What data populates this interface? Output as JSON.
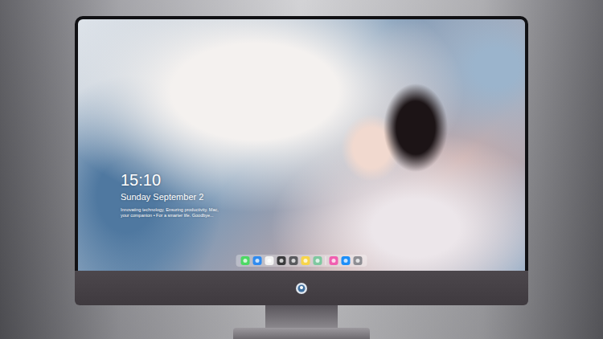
{
  "clock": {
    "time": "15:10",
    "date": "Sunday September 2",
    "tagline_lines": [
      "Innovating technology, Ensuring productivity. Mac,",
      "your companion • For a smarter life. Goodbye..."
    ]
  },
  "dock": {
    "apps": [
      {
        "color": "#4cd964"
      },
      {
        "color": "#2f8bf0"
      },
      {
        "color": "#f2f2f2"
      },
      {
        "color": "#3a3a3c"
      },
      {
        "color": "#5a5a5e"
      },
      {
        "color": "#f7d54a"
      },
      {
        "color": "#7fc8a0"
      }
    ],
    "extras": [
      {
        "color": "#f05fb0"
      },
      {
        "color": "#1c8ef9"
      },
      {
        "color": "#8e8e93"
      }
    ]
  }
}
